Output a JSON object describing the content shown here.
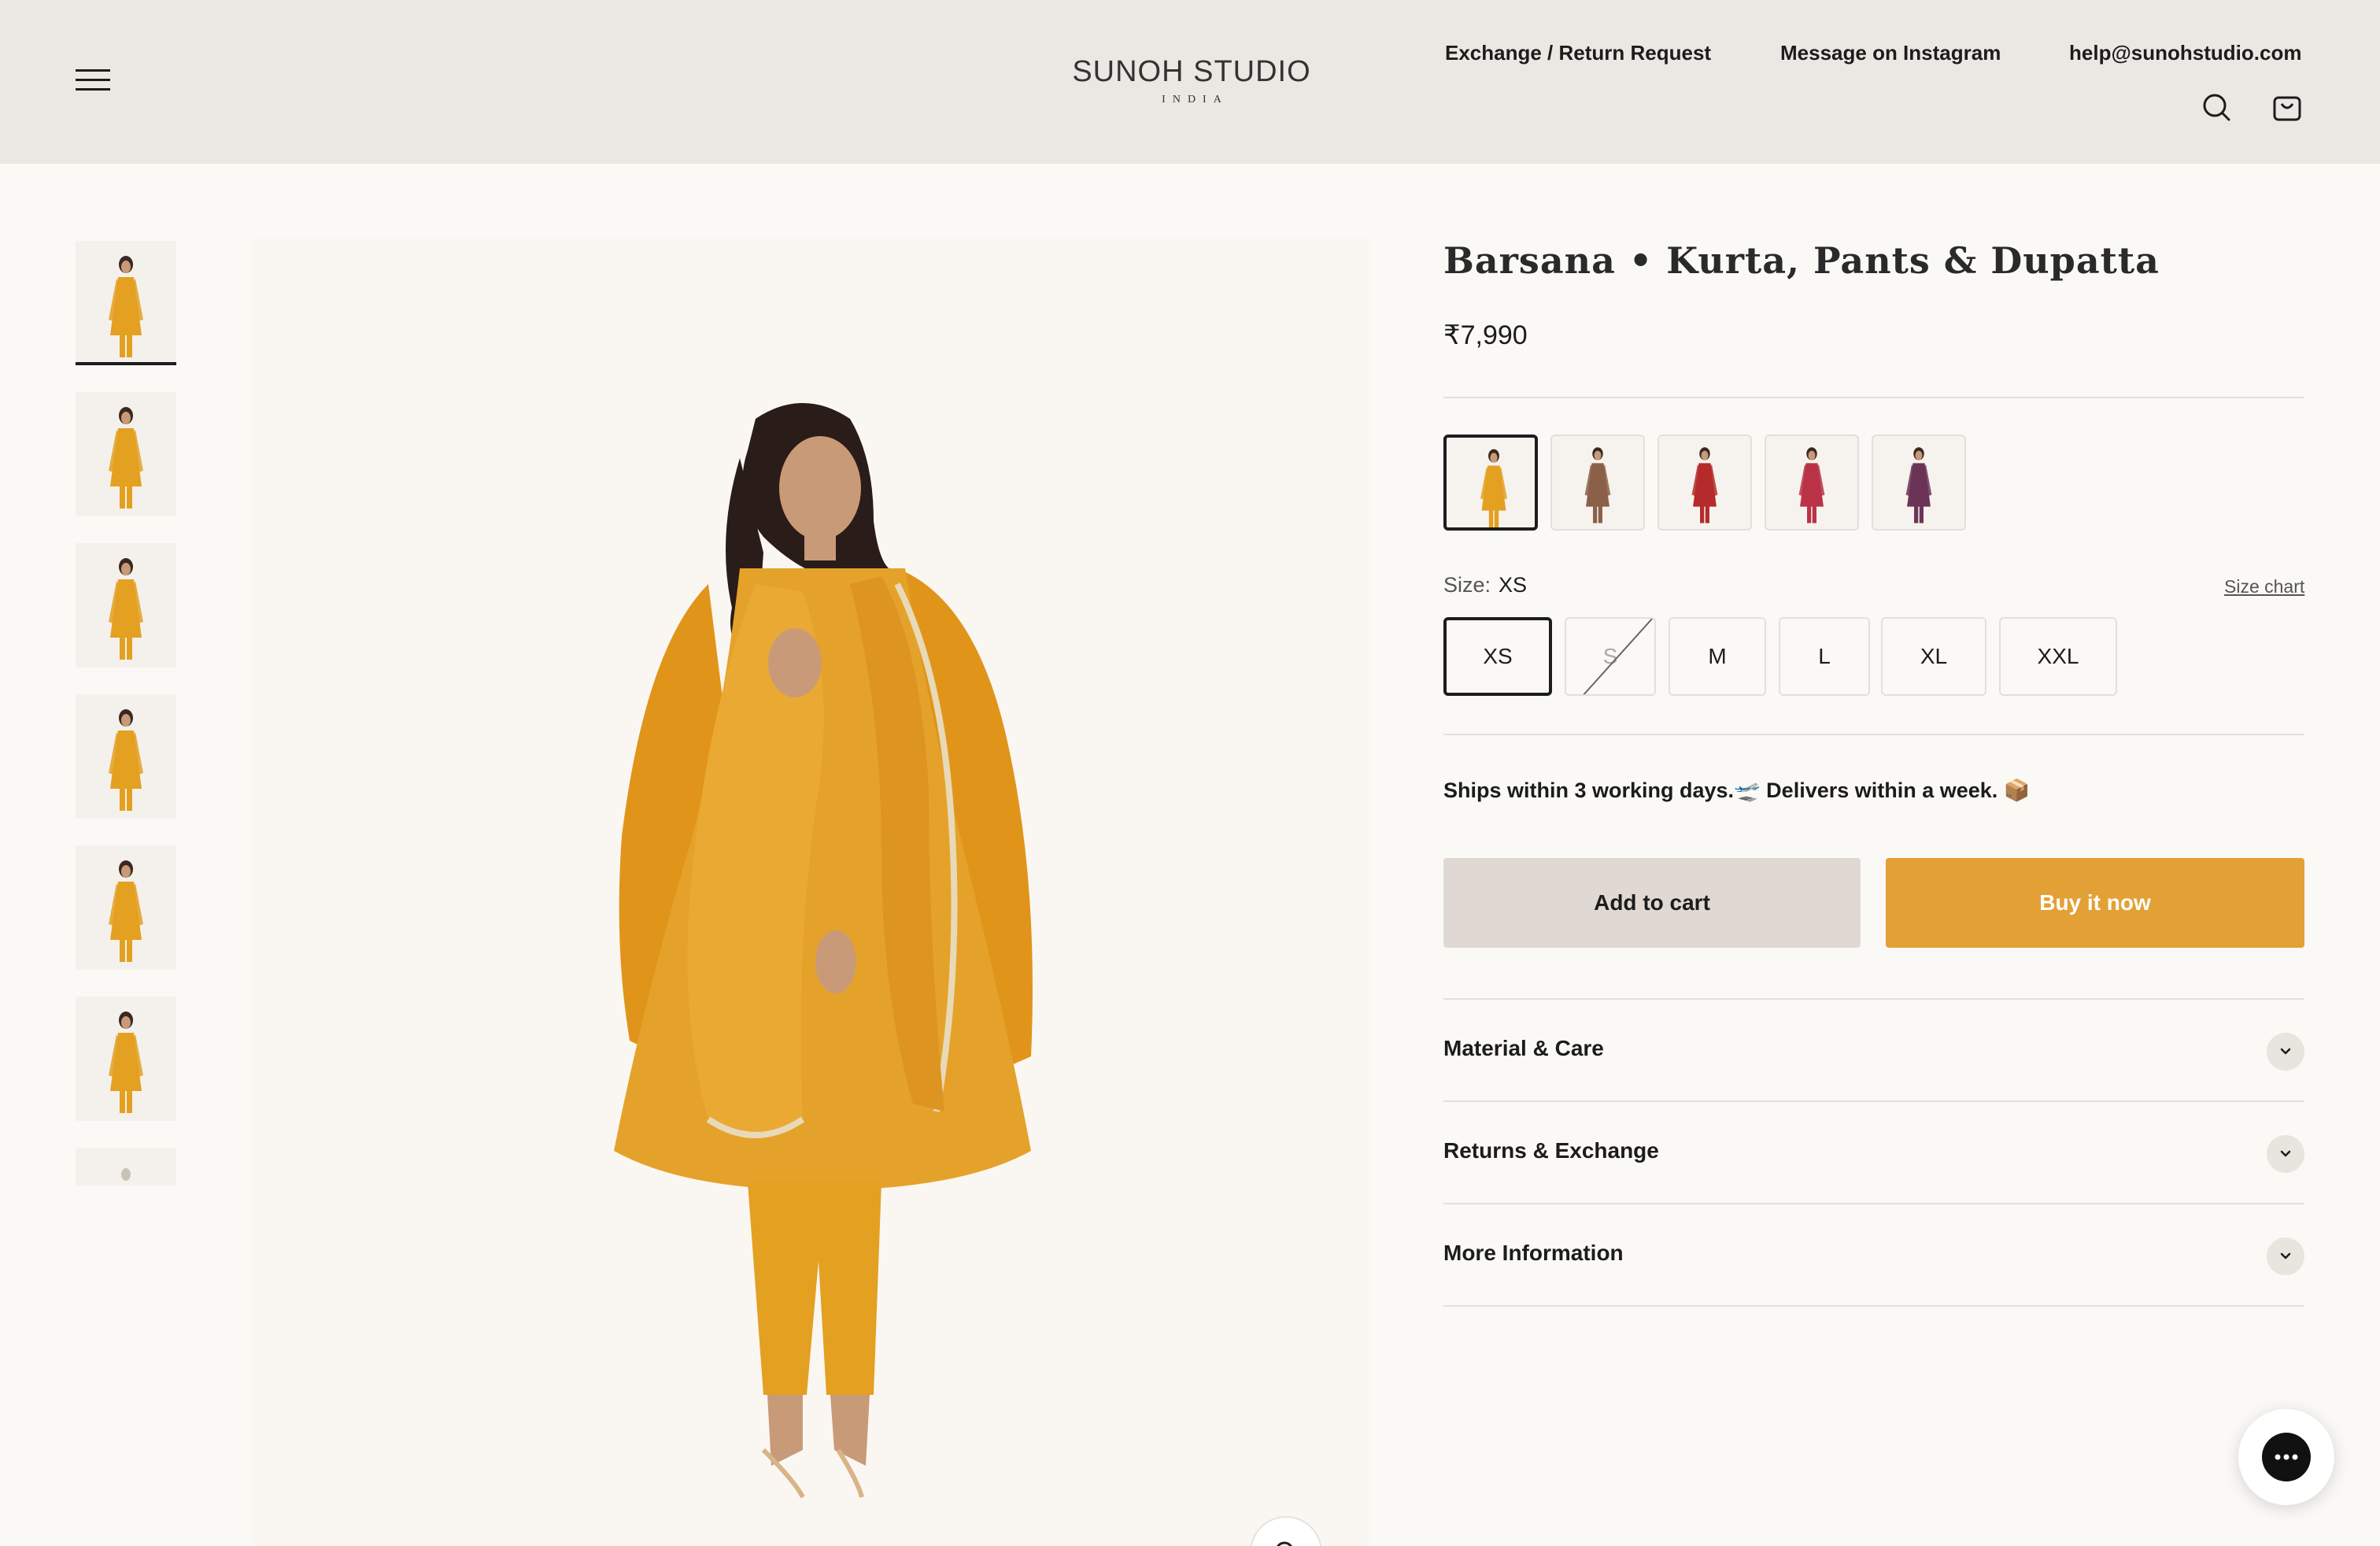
{
  "header": {
    "logo_brand": "SUNOH STUDIO",
    "logo_sub": "INDIA",
    "nav": [
      {
        "label": "Exchange / Return Request"
      },
      {
        "label": "Message on Instagram"
      },
      {
        "label": "help@sunohstudio.com"
      }
    ]
  },
  "gallery": {
    "thumbnail_count": 7,
    "active_index": 0
  },
  "product": {
    "title": "Barsana • Kurta, Pants & Dupatta",
    "price": "₹7,990",
    "swatch_colors": [
      "#e3a021",
      "#8a6048",
      "#b52a2a",
      "#b93246",
      "#6b3456"
    ],
    "size_label": "Size:",
    "selected_size": "XS",
    "size_chart_label": "Size chart",
    "sizes": [
      {
        "label": "XS",
        "state": "selected"
      },
      {
        "label": "S",
        "state": "unavailable"
      },
      {
        "label": "M",
        "state": "available"
      },
      {
        "label": "L",
        "state": "available"
      },
      {
        "label": "XL",
        "state": "available"
      },
      {
        "label": "XXL",
        "state": "available"
      }
    ],
    "shipping": "Ships within 3 working days.🛫  Delivers within a week. 📦",
    "add_to_cart": "Add to cart",
    "buy_now": "Buy it now",
    "accordions": [
      {
        "label": "Material & Care"
      },
      {
        "label": "Returns & Exchange"
      },
      {
        "label": "More Information"
      }
    ]
  },
  "colors": {
    "header_bg": "#ebe8e3",
    "page_bg": "#fbf9f6",
    "accent_buy": "#e3a035",
    "cart_bg": "#e0d9d3",
    "garment": "#e3a021"
  },
  "icons": [
    "menu-icon",
    "search-icon",
    "bag-icon",
    "chevron-down-icon",
    "chat-icon",
    "zoom-icon"
  ]
}
